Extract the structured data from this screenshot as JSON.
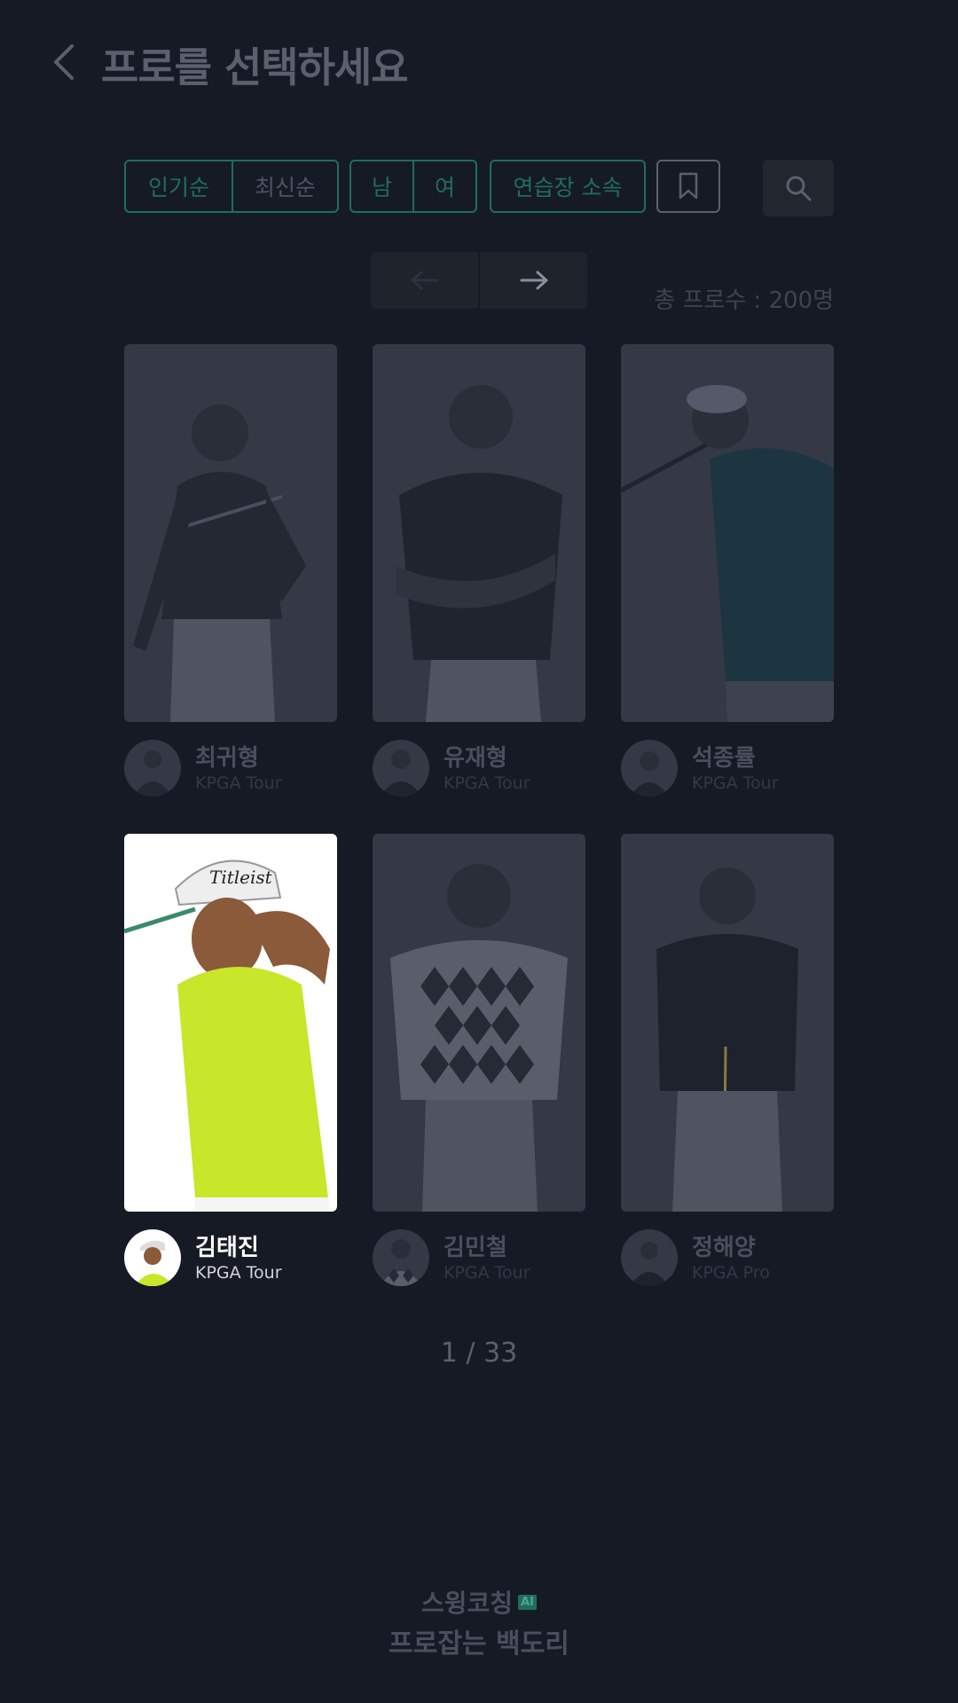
{
  "header": {
    "title": "프로를 선택하세요"
  },
  "filters": {
    "sort_popular": "인기순",
    "sort_latest": "최신순",
    "gender_male": "남",
    "gender_female": "여",
    "academy": "연습장 소속"
  },
  "total_count": "총 프로수 : 200명",
  "pros": [
    {
      "name": "최귀형",
      "tour": "KPGA Tour",
      "selected": false
    },
    {
      "name": "유재형",
      "tour": "KPGA Tour",
      "selected": false
    },
    {
      "name": "석종률",
      "tour": "KPGA Tour",
      "selected": false
    },
    {
      "name": "김태진",
      "tour": "KPGA Tour",
      "selected": true
    },
    {
      "name": "김민철",
      "tour": "KPGA Tour",
      "selected": false
    },
    {
      "name": "정해양",
      "tour": "KPGA Pro",
      "selected": false
    }
  ],
  "page_indicator": "1 / 33",
  "footer": {
    "line1": "스윙코칭",
    "ai_badge": "AI",
    "line2": "프로잡는 백도리"
  },
  "colors": {
    "background": "#161a25",
    "accent": "#1f6e5c",
    "selected_shirt": "#c8e62a"
  }
}
